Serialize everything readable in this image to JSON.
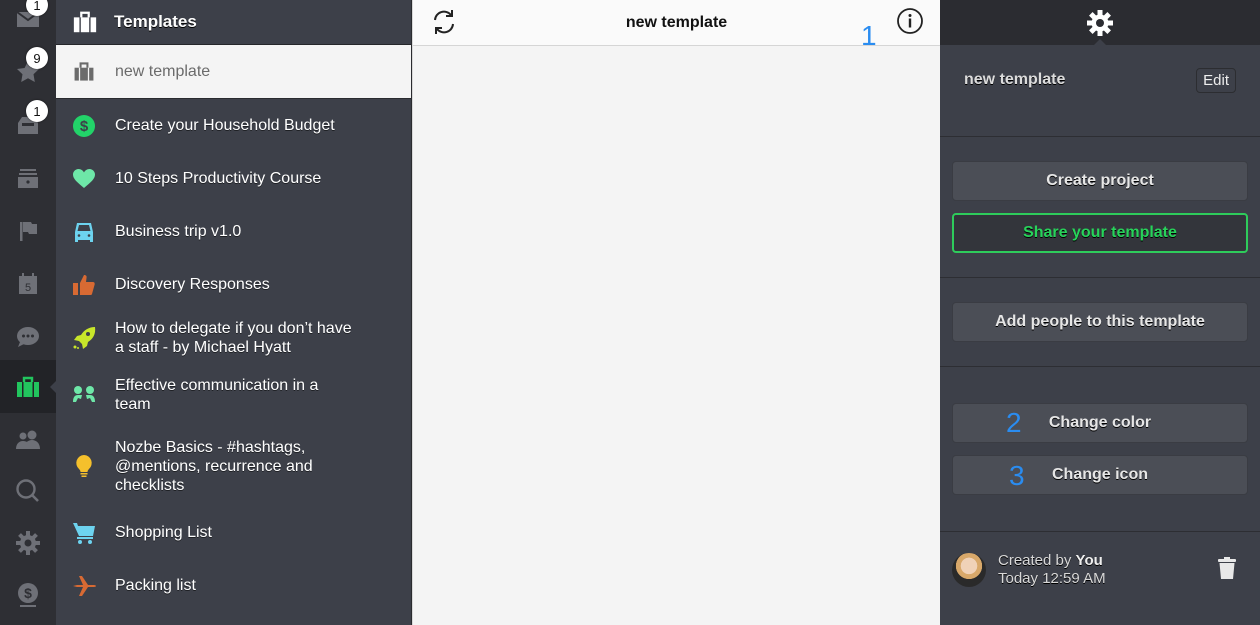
{
  "rail": {
    "items": [
      {
        "name": "messages",
        "icon": "envelope-icon",
        "badge": "1"
      },
      {
        "name": "priority",
        "icon": "star-icon",
        "badge": "9"
      },
      {
        "name": "inbox",
        "icon": "inbox-tray-icon",
        "badge": "1"
      },
      {
        "name": "projects",
        "icon": "archive-box-icon",
        "badge": null
      },
      {
        "name": "categories",
        "icon": "flag-icon",
        "badge": null
      },
      {
        "name": "calendar",
        "icon": "calendar-icon",
        "badge": null,
        "calendar_day": "5"
      },
      {
        "name": "comments",
        "icon": "speech-bubble-icon",
        "badge": null
      },
      {
        "name": "templates",
        "icon": "suitcase-icon",
        "badge": null,
        "active": true
      },
      {
        "name": "team",
        "icon": "people-icon",
        "badge": null
      },
      {
        "name": "search",
        "icon": "search-icon",
        "badge": null
      },
      {
        "name": "settings",
        "icon": "gear-icon",
        "badge": null
      },
      {
        "name": "billing",
        "icon": "dollar-coin-icon",
        "badge": null
      }
    ],
    "active_color": "#22c55e"
  },
  "templates_list": {
    "header_title": "Templates",
    "items": [
      {
        "label": "new template",
        "icon": "suitcase-icon",
        "color": "#6b6b6b",
        "selected": true
      },
      {
        "label": "Create your Household Budget",
        "icon": "dollar-circle-icon",
        "color": "#22d369"
      },
      {
        "label": "10 Steps Productivity Course",
        "icon": "heart-icon",
        "color": "#6ee7a8"
      },
      {
        "label": "Business trip v1.0",
        "icon": "car-icon",
        "color": "#6dd3ef"
      },
      {
        "label": "Discovery Responses",
        "icon": "thumbs-up-icon",
        "color": "#d86a33"
      },
      {
        "label": "How to delegate if you don’t have a staff - by Michael Hyatt",
        "icon": "rocket-icon",
        "color": "#c8e62a"
      },
      {
        "label": "Effective communication in a team",
        "icon": "two-people-icon",
        "color": "#6ee7a8"
      },
      {
        "label": "Nozbe Basics - #hashtags, @mentions, recurrence and checklists",
        "icon": "lightbulb-icon",
        "color": "#f5c02c"
      },
      {
        "label": "Shopping List",
        "icon": "shopping-cart-icon",
        "color": "#6dd3ef"
      },
      {
        "label": "Packing list",
        "icon": "airplane-icon",
        "color": "#d86a33"
      }
    ]
  },
  "center": {
    "title": "new template",
    "refresh_icon": "refresh-icon",
    "info_icon": "info-icon"
  },
  "annotations": [
    "1",
    "2",
    "3"
  ],
  "details": {
    "header_icon": "gear-icon",
    "template_name": "new template",
    "edit_label": "Edit",
    "create_project_label": "Create project",
    "share_label": "Share your template",
    "add_people_label": "Add people to this template",
    "change_color_label": "Change color",
    "change_icon_label": "Change icon",
    "created_by_prefix": "Created by",
    "created_by_name": "You",
    "created_time": "Today 12:59 AM",
    "share_color": "#27d35a"
  }
}
